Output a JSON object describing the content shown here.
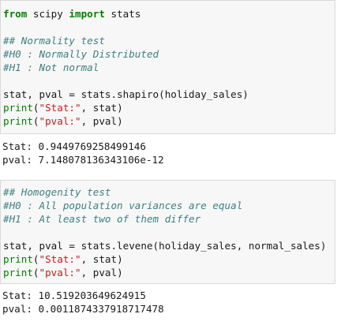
{
  "cells": [
    {
      "input": {
        "import": {
          "kw_from": "from",
          "module": " scipy ",
          "kw_import": "import",
          "name": " stats"
        },
        "comments": [
          "## Normality test",
          "#H0 : Normally Distributed",
          "#H1 : Not normal"
        ],
        "call": "stat, pval = stats.shapiro(holiday_sales)",
        "print1": {
          "fn": "print",
          "open": "(",
          "str": "\"Stat:\"",
          "rest": ", stat)"
        },
        "print2": {
          "fn": "print",
          "open": "(",
          "str": "\"pval:\"",
          "rest": ", pval)"
        }
      },
      "output": [
        "Stat: 0.9449769258499146",
        "pval: 7.148078136343106e-12"
      ]
    },
    {
      "input": {
        "comments": [
          "## Homogenity test",
          "#H0 : All population variances are equal",
          "#H1 : At least two of them differ"
        ],
        "call": "stat, pval = stats.levene(holiday_sales, normal_sales)",
        "print1": {
          "fn": "print",
          "open": "(",
          "str": "\"Stat:\"",
          "rest": ", stat)"
        },
        "print2": {
          "fn": "print",
          "open": "(",
          "str": "\"pval:\"",
          "rest": ", pval)"
        }
      },
      "output": [
        "Stat: 10.519203649624915",
        "pval: 0.0011874337918717478"
      ]
    }
  ]
}
